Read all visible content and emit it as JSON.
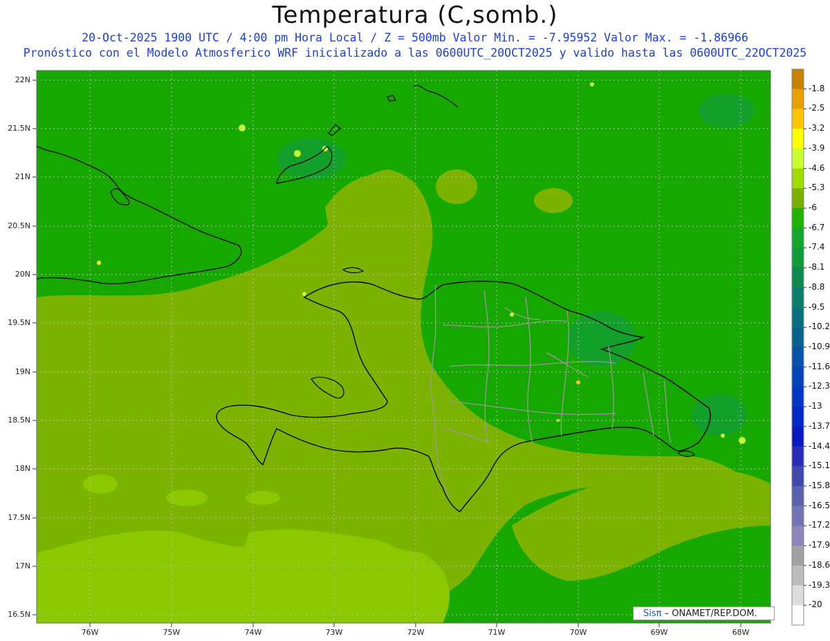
{
  "title": "Temperatura (C,somb.)",
  "subtitle_line1": "20-Oct-2025  1900 UTC / 4:00 pm Hora Local / Z = 500mb  Valor Min. = -7.95952  Valor Max. = -1.86966",
  "subtitle_line2": "Pronóstico con el Modelo Atmosferico WRF inicializado a las 0600UTC_20OCT2025 y valido hasta las  0600UTC_22OCT2025",
  "map": {
    "lat_labels": [
      "22N",
      "21.5N",
      "21N",
      "20.5N",
      "20N",
      "19.5N",
      "19N",
      "18.5N",
      "18N",
      "17.5N",
      "17N",
      "16.5N"
    ],
    "lon_labels": [
      "76W",
      "75W",
      "74W",
      "73W",
      "72W",
      "71W",
      "70W",
      "69W",
      "68W"
    ]
  },
  "colorbar": {
    "labels": [
      "-1.8",
      "-2.5",
      "-3.2",
      "-3.9",
      "-4.6",
      "-5.3",
      "-6",
      "-6.7",
      "-7.4",
      "-8.1",
      "-8.8",
      "-9.5",
      "-10.2",
      "-10.9",
      "-11.6",
      "-12.3",
      "-13",
      "-13.7",
      "-14.4",
      "-15.1",
      "-15.8",
      "-16.5",
      "-17.2",
      "-17.9",
      "-18.6",
      "-19.3",
      "-20"
    ],
    "colors": [
      "#c78200",
      "#e8a000",
      "#ffc400",
      "#ffff00",
      "#c8ff30",
      "#a0dc00",
      "#7cb000",
      "#1fb300",
      "#12a82e",
      "#0f9a3c",
      "#0c8a50",
      "#0a7e66",
      "#08707c",
      "#076290",
      "#0652a8",
      "#0444b8",
      "#0236c4",
      "#0228c8",
      "#0a18c0",
      "#2a2cb8",
      "#4048b0",
      "#5a62b0",
      "#7474b4",
      "#8e86b8",
      "#a0a0a0",
      "#bcbcbc",
      "#dcdcdc",
      "#ffffff"
    ]
  },
  "credit": {
    "logo": "Sisπ",
    "text": "– ONAMET/REP.DOM."
  }
}
